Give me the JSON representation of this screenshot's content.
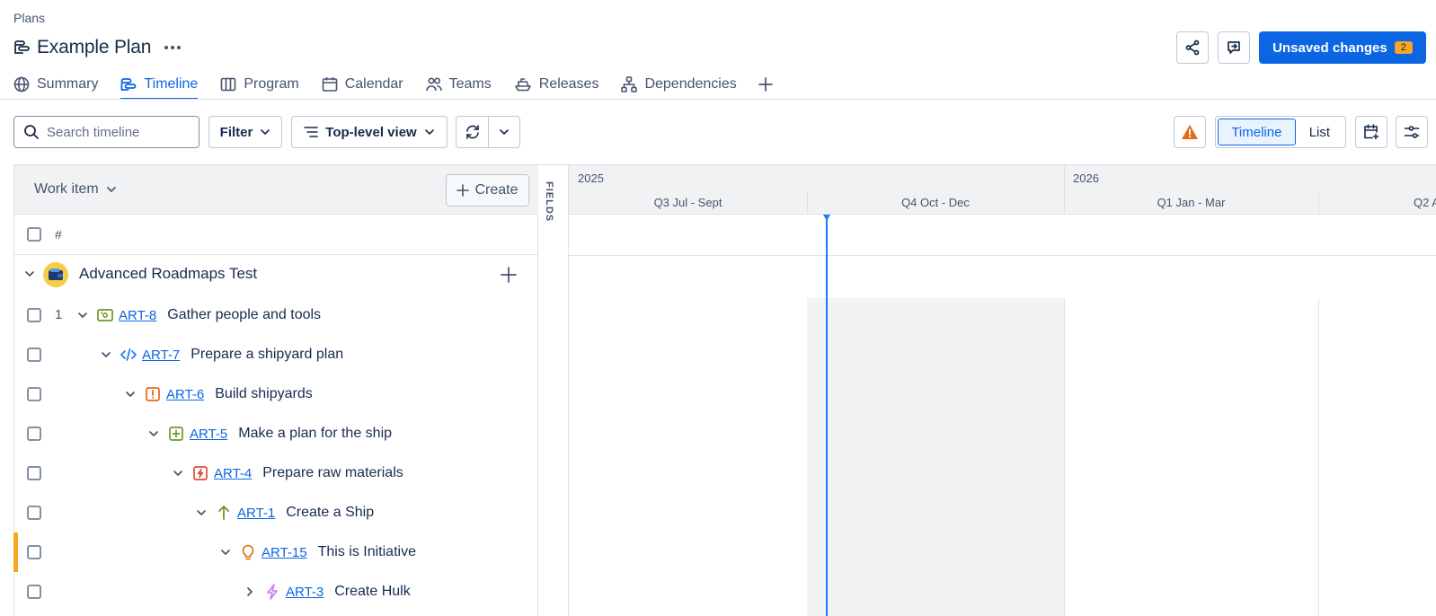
{
  "breadcrumb": "Plans",
  "plan_title": "Example Plan",
  "header": {
    "unsaved_label": "Unsaved changes",
    "unsaved_count": "2",
    "accent_color": "#0c66e4"
  },
  "tabs": [
    {
      "label": "Summary",
      "icon": "globe-icon"
    },
    {
      "label": "Timeline",
      "icon": "timeline-icon",
      "active": true
    },
    {
      "label": "Program",
      "icon": "board-icon"
    },
    {
      "label": "Calendar",
      "icon": "calendar-icon"
    },
    {
      "label": "Teams",
      "icon": "people-icon"
    },
    {
      "label": "Releases",
      "icon": "ship-icon"
    },
    {
      "label": "Dependencies",
      "icon": "hierarchy-icon"
    }
  ],
  "toolbar": {
    "search_placeholder": "Search timeline",
    "filter_label": "Filter",
    "view_label": "Top-level view",
    "timeline_label": "Timeline",
    "list_label": "List"
  },
  "panel": {
    "work_item_label": "Work item",
    "create_label": "Create",
    "hash_label": "#",
    "fields_label": "FIELDS"
  },
  "group": {
    "name": "Advanced Roadmaps Test"
  },
  "rows": [
    {
      "num": "1",
      "key": "ART-8",
      "summary": "Gather people and tools",
      "type": "epic-icon",
      "type_color": "#6a9a23",
      "expanded": true
    },
    {
      "num": "",
      "key": "ART-7",
      "summary": "Prepare a shipyard plan",
      "type": "code-icon",
      "type_color": "#1d7afc",
      "expanded": true
    },
    {
      "num": "",
      "key": "ART-6",
      "summary": "Build shipyards",
      "type": "bug-alert-icon",
      "type_color": "#e56910",
      "expanded": true
    },
    {
      "num": "",
      "key": "ART-5",
      "summary": "Make a plan for the ship",
      "type": "add-box-icon",
      "type_color": "#6a9a23",
      "expanded": true
    },
    {
      "num": "",
      "key": "ART-4",
      "summary": "Prepare raw materials",
      "type": "lightning-box-icon",
      "type_color": "#e2483d",
      "expanded": true
    },
    {
      "num": "",
      "key": "ART-1",
      "summary": "Create a Ship",
      "type": "arrow-up-icon",
      "type_color": "#6a9a23",
      "expanded": true
    },
    {
      "num": "",
      "key": "ART-15",
      "summary": "This is Initiative",
      "type": "lightbulb-icon",
      "type_color": "#d97008",
      "expanded": true,
      "flagged": true
    },
    {
      "num": "",
      "key": "ART-3",
      "summary": "Create Hulk",
      "type": "lightning-icon",
      "type_color": "#c97cf4",
      "expanded": false
    }
  ],
  "timeline": {
    "years": [
      "2025",
      "2026"
    ],
    "quarters": [
      "Q3 Jul - Sept",
      "Q4 Oct - Dec",
      "Q1 Jan - Mar",
      "Q2 A"
    ]
  }
}
